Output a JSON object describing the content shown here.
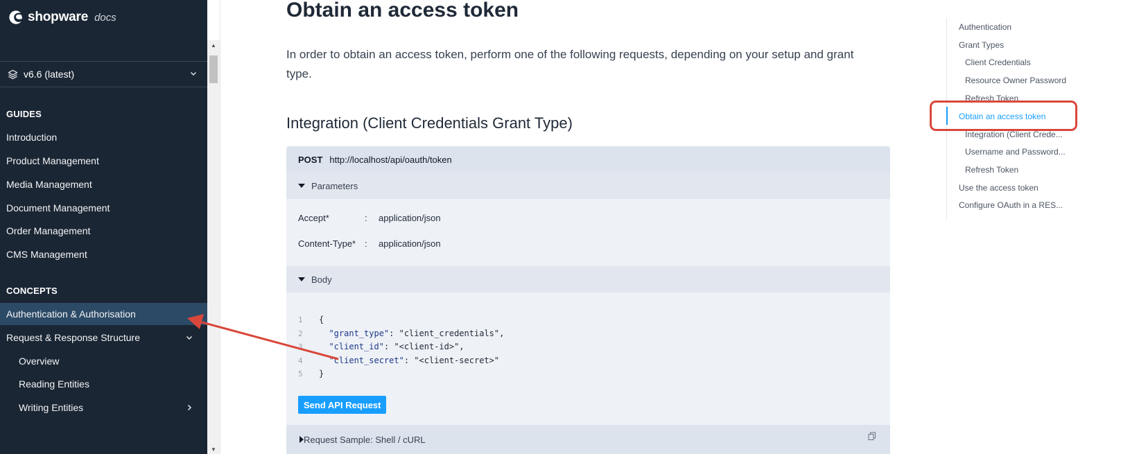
{
  "brand": {
    "name": "shopware",
    "suffix": "docs"
  },
  "version": {
    "label": "v6.6 (latest)"
  },
  "sidebar": {
    "sections": [
      {
        "title": "GUIDES",
        "items": [
          "Introduction",
          "Product Management",
          "Media Management",
          "Document Management",
          "Order Management",
          "CMS Management"
        ]
      },
      {
        "title": "CONCEPTS",
        "items": [
          "Authentication & Authorisation",
          "Request & Response Structure",
          "Overview",
          "Reading Entities",
          "Writing Entities"
        ]
      }
    ],
    "active_item": "Authentication & Authorisation"
  },
  "main": {
    "title": "Obtain an access token",
    "intro": "In order to obtain an access token, perform one of the following requests, depending on your setup and grant type.",
    "section_heading": "Integration (Client Credentials Grant Type)",
    "api": {
      "method": "POST",
      "url": "http://localhost/api/oauth/token",
      "parameters_label": "Parameters",
      "params": [
        {
          "name": "Accept*",
          "value": "application/json"
        },
        {
          "name": "Content-Type*",
          "value": "application/json"
        }
      ],
      "body_label": "Body",
      "body_lines": [
        {
          "n": "1",
          "text": "{"
        },
        {
          "n": "2",
          "key": "\"grant_type\"",
          "val": "\"client_credentials\","
        },
        {
          "n": "3",
          "key": "\"client_id\"",
          "val": "\"<client-id>\","
        },
        {
          "n": "4",
          "key": "\"client_secret\"",
          "val": "\"<client-secret>\""
        },
        {
          "n": "5",
          "text": "}"
        }
      ],
      "send_label": "Send API Request",
      "sample_label": "Request Sample: Shell / cURL"
    }
  },
  "toc": {
    "items": [
      {
        "label": "Authentication",
        "level": 1
      },
      {
        "label": "Grant Types",
        "level": 1
      },
      {
        "label": "Client Credentials",
        "level": 2
      },
      {
        "label": "Resource Owner Password",
        "level": 2
      },
      {
        "label": "Refresh Token",
        "level": 2
      },
      {
        "label": "Obtain an access token",
        "level": 1,
        "active": true
      },
      {
        "label": "Integration (Client Crede...",
        "level": 2
      },
      {
        "label": "Username and Password...",
        "level": 2
      },
      {
        "label": "Refresh Token",
        "level": 2
      },
      {
        "label": "Use the access token",
        "level": 1
      },
      {
        "label": "Configure OAuth in a RES...",
        "level": 1
      }
    ]
  },
  "colors": {
    "sidebar_bg": "#1b2634",
    "accent": "#189eff",
    "annotation": "#d9473a"
  }
}
